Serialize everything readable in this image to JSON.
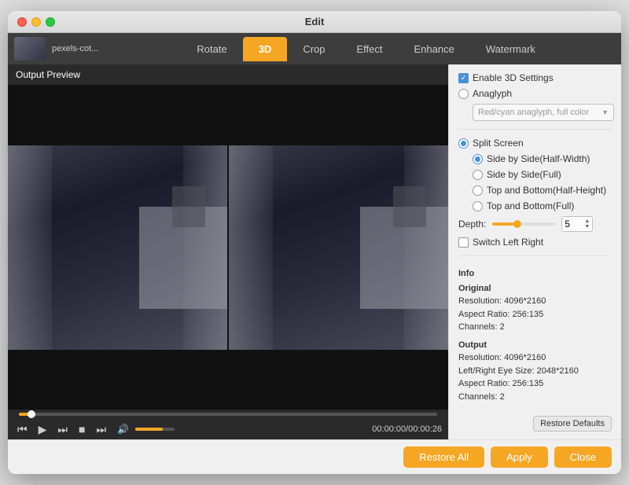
{
  "window": {
    "title": "Edit"
  },
  "toolbar": {
    "filename": "pexels-cot...",
    "tabs": [
      {
        "label": "Rotate",
        "active": false
      },
      {
        "label": "3D",
        "active": true
      },
      {
        "label": "Crop",
        "active": false
      },
      {
        "label": "Effect",
        "active": false
      },
      {
        "label": "Enhance",
        "active": false
      },
      {
        "label": "Watermark",
        "active": false
      }
    ]
  },
  "preview": {
    "label": "Output Preview"
  },
  "controls": {
    "time": "00:00:00/00:00:26"
  },
  "panel": {
    "enable_3d_label": "Enable 3D Settings",
    "anaglyph_label": "Anaglyph",
    "anaglyph_option": "Red/cyan anaglyph, full color",
    "split_screen_label": "Split Screen",
    "side_by_side_half_label": "Side by Side(Half-Width)",
    "side_by_side_full_label": "Side by Side(Full)",
    "top_bottom_half_label": "Top and Bottom(Half-Height)",
    "top_bottom_full_label": "Top and Bottom(Full)",
    "depth_label": "Depth:",
    "depth_value": "5",
    "switch_left_right_label": "Switch Left Right"
  },
  "info": {
    "section_title": "Info",
    "original_title": "Original",
    "original_resolution": "Resolution: 4096*2160",
    "original_aspect": "Aspect Ratio: 256:135",
    "original_channels": "Channels: 2",
    "output_title": "Output",
    "output_resolution": "Resolution: 4096*2160",
    "output_eye_size": "Left/Right Eye Size: 2048*2160",
    "output_aspect": "Aspect Ratio: 256:135",
    "output_channels": "Channels: 2"
  },
  "buttons": {
    "restore_defaults": "Restore Defaults",
    "restore_all": "Restore All",
    "apply": "Apply",
    "close": "Close"
  }
}
